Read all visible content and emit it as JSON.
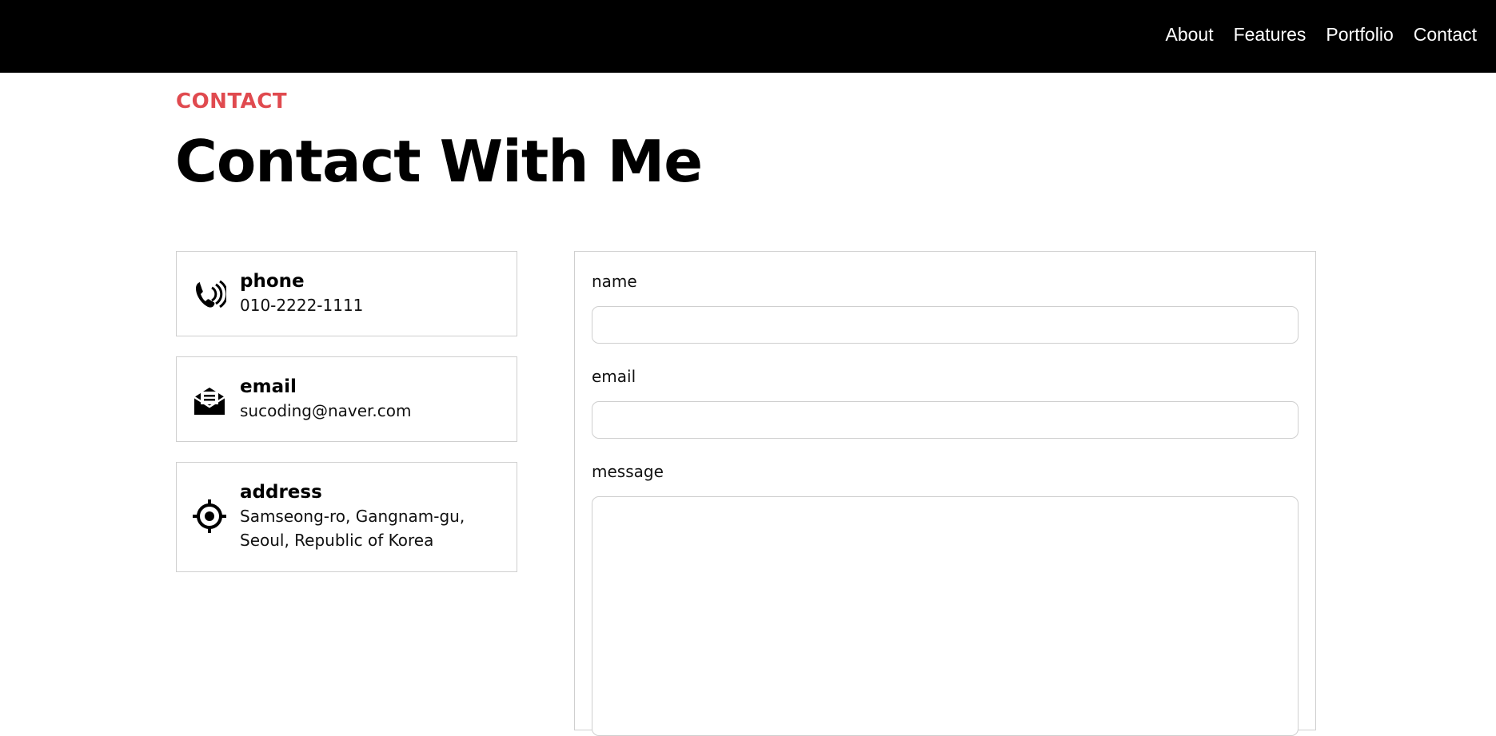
{
  "nav": {
    "items": [
      "About",
      "Features",
      "Portfolio",
      "Contact"
    ]
  },
  "section": {
    "label": "CONTACT",
    "title": "Contact With Me",
    "accent_color": "#e04a4f"
  },
  "info": {
    "phone": {
      "title": "phone",
      "value": "010-2222-1111",
      "icon": "phone-icon"
    },
    "email": {
      "title": "email",
      "value": "sucoding@naver.com",
      "icon": "envelope-icon"
    },
    "address": {
      "title": "address",
      "line1": "Samseong-ro, Gangnam-gu,",
      "line2": "Seoul, Republic of Korea",
      "icon": "location-target-icon"
    }
  },
  "form": {
    "name_label": "name",
    "name_value": "",
    "email_label": "email",
    "email_value": "",
    "message_label": "message",
    "message_value": ""
  }
}
